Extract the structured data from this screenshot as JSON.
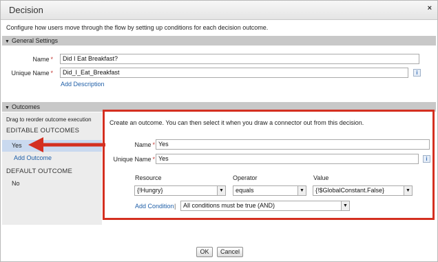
{
  "dialog": {
    "title": "Decision",
    "close": "×",
    "intro": "Configure how users move through the flow by setting up conditions for each decision outcome."
  },
  "general": {
    "header": "General Settings",
    "name_label": "Name",
    "name_value": "Did I Eat Breakfast?",
    "unique_label": "Unique Name",
    "unique_value": "Did_I_Eat_Breakfast",
    "info": "i",
    "add_description": "Add Description"
  },
  "outcomes": {
    "header": "Outcomes",
    "drag_note": "Drag to reorder outcome execution",
    "editable_heading": "EDITABLE OUTCOMES",
    "editable_items": [
      "Yes"
    ],
    "add_outcome": "Add Outcome",
    "default_heading": "DEFAULT OUTCOME",
    "default_item": "No"
  },
  "editor": {
    "intro": "Create an outcome.  You can then select it when you draw a connector out from this decision.",
    "name_label": "Name",
    "name_value": "Yes",
    "unique_label": "Unique Name",
    "unique_value": "Yes",
    "info": "i",
    "col_resource": "Resource",
    "col_operator": "Operator",
    "col_value": "Value",
    "resource": "{!Hungry}",
    "operator": "equals",
    "value": "{!$GlobalConstant.False}",
    "add_condition": "Add Condition",
    "separator": "|",
    "logic": "All conditions must be true (AND)"
  },
  "footer": {
    "ok": "OK",
    "cancel": "Cancel"
  },
  "colors": {
    "highlight_red": "#d42f20",
    "link_blue": "#1f5fa8",
    "selected_row": "#c9d9ef",
    "section_bar": "#c8c8c8"
  }
}
